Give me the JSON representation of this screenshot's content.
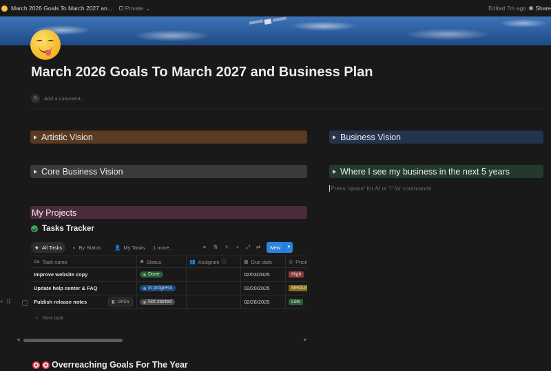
{
  "topbar": {
    "title": "March 2026 Goals To March 2027 an...",
    "privacy": "Private",
    "edited": "Edited 7m ago",
    "share": "Share"
  },
  "page": {
    "title": "March 2026 Goals To March 2027 and Business Plan",
    "comment_avatar": "R",
    "comment_placeholder": "Add a comment...",
    "hint": "Press 'space' for AI or '/' for commands"
  },
  "toggles": {
    "artistic": "Artistic Vision",
    "business": "Business Vision",
    "core": "Core Business Vision",
    "five_years": "Where I see my business in the next 5 years"
  },
  "projects": {
    "heading": "My Projects",
    "tracker_title": "Tasks Tracker",
    "views": [
      "All Tasks",
      "By Status",
      "My Tasks",
      "1 more..."
    ],
    "new_label": "New",
    "columns": [
      "Task name",
      "Status",
      "Assignee",
      "Due date",
      "Priority"
    ],
    "rows": [
      {
        "name": "Improve website copy",
        "status": "Done",
        "assignee": "",
        "due": "02/03/2025",
        "priority": "High"
      },
      {
        "name": "Update help center & FAQ",
        "status": "In progress",
        "assignee": "",
        "due": "02/20/2025",
        "priority": "Medium"
      },
      {
        "name": "Publish release notes",
        "status": "Not started",
        "assignee": "",
        "due": "02/28/2025",
        "priority": "Low"
      }
    ],
    "open_label": "OPEN",
    "new_task": "New task"
  },
  "goals": {
    "heading": "Overreaching Goals For The Year"
  },
  "colors": {
    "artistic": "#5a3a20",
    "business": "#24344d",
    "core": "#3a3a3a",
    "five_years": "#24392b",
    "projects": "#4b2b3c",
    "status_done": "#2b5b3a",
    "status_progress": "#1f4a7a",
    "status_not_started": "#4a4a4a",
    "priority_high": "#8a3a36",
    "priority_medium": "#8a6a20",
    "priority_low": "#2f5a3c",
    "accent": "#2a83e0"
  }
}
